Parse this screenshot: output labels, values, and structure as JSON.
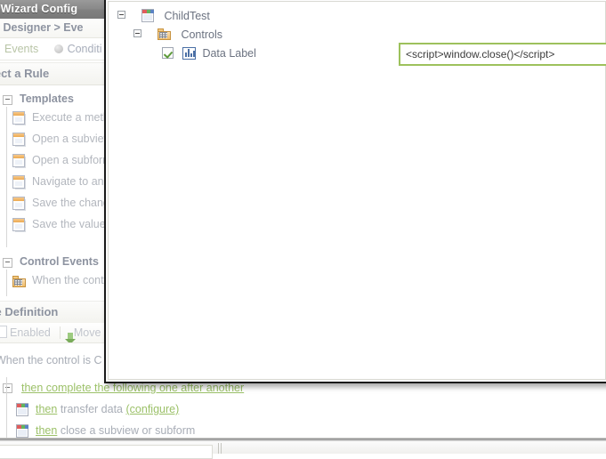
{
  "window": {
    "title": "les Wizard Config",
    "breadcrumb": "ule Designer > Eve"
  },
  "tabs": [
    {
      "label": "Events",
      "state": "selected",
      "indicator": "radio-on"
    },
    {
      "label": "Conditi",
      "state": "unselected",
      "indicator": "radio-off"
    }
  ],
  "sections": {
    "select_a_rule": "elect a Rule",
    "rule_definition": "ule Definition"
  },
  "templates": {
    "group_label": "Templates",
    "items": [
      {
        "label": "Execute a meth",
        "icon": "form-icon"
      },
      {
        "label": "Open a subview",
        "icon": "form-icon"
      },
      {
        "label": "Open a subform",
        "icon": "form-icon"
      },
      {
        "label": "Navigate to anc",
        "icon": "form-icon"
      },
      {
        "label": "Save the chang",
        "icon": "form-icon"
      },
      {
        "label": "Save the value",
        "icon": "form-icon"
      }
    ]
  },
  "control_events": {
    "group_label": "Control Events",
    "items": [
      {
        "label": "When the contr",
        "icon": "open-folder-icon"
      }
    ]
  },
  "rule_definition_toolbar": {
    "enabled_label": "Enabled",
    "move_label": "Move D",
    "checkbox_checked": false,
    "move_icon": "arrow-down-icon"
  },
  "rule_statement": {
    "prefix": "When the control is C",
    "then_group": "then complete the following one after another",
    "rows": [
      {
        "then": "then",
        "text": "transfer data",
        "link": "(configure)",
        "icon": "form-rgb-icon"
      },
      {
        "then": "then",
        "text": "close a subview or subform",
        "link": "",
        "icon": "form-rgb-icon"
      }
    ]
  },
  "popup": {
    "tree": [
      {
        "level": 1,
        "label": "ChildTest",
        "icon": "form-rgb-icon",
        "expander": "minus",
        "checkbox": false
      },
      {
        "level": 2,
        "label": "Controls",
        "icon": "folder-grid-icon",
        "expander": "minus",
        "checkbox": false
      },
      {
        "level": 3,
        "label": "Data Label",
        "icon": "chart-icon",
        "expander": "none",
        "checkbox": true
      }
    ],
    "script_input": {
      "value": "<script>window.close()</script>",
      "placeholder": ""
    }
  },
  "colors": {
    "accent_green": "#9dc15c",
    "titlebar_gray": "#808080",
    "link_green": "#9cc169",
    "popup_border": "#1a1a1a"
  }
}
